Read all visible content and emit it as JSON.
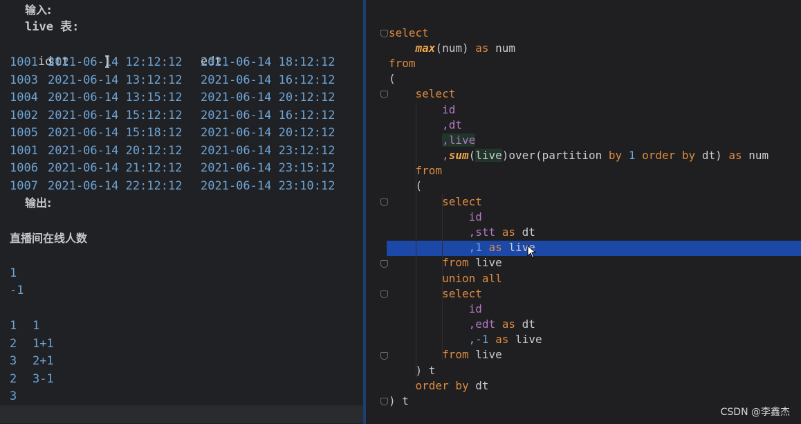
{
  "left": {
    "input_label": "输入:",
    "table_label": "live 表:",
    "header": [
      "id",
      "stt",
      "edt"
    ],
    "rows": [
      [
        "1001",
        "2021-06-14 12:12:12",
        "2021-06-14 18:12:12"
      ],
      [
        "1003",
        "2021-06-14 13:12:12",
        "2021-06-14 16:12:12"
      ],
      [
        "1004",
        "2021-06-14 13:15:12",
        "2021-06-14 20:12:12"
      ],
      [
        "1002",
        "2021-06-14 15:12:12",
        "2021-06-14 16:12:12"
      ],
      [
        "1005",
        "2021-06-14 15:18:12",
        "2021-06-14 20:12:12"
      ],
      [
        "1001",
        "2021-06-14 20:12:12",
        "2021-06-14 23:12:12"
      ],
      [
        "1006",
        "2021-06-14 21:12:12",
        "2021-06-14 23:15:12"
      ],
      [
        "1007",
        "2021-06-14 22:12:12",
        "2021-06-14 23:10:12"
      ]
    ],
    "output_label": "输出:",
    "note_title": "直播间在线人数",
    "plus_one": "1",
    "minus_one": "-1",
    "calc": [
      [
        "1",
        "1"
      ],
      [
        "2",
        "1+1"
      ],
      [
        "3",
        "2+1"
      ],
      [
        "2",
        "3-1"
      ],
      [
        "3",
        ""
      ]
    ],
    "last_line_fn": "sum",
    "last_line_parens": "()"
  },
  "sql": {
    "l1_select": "select",
    "l2_max": "max",
    "l2_args": "(num)",
    "l2_as": "as",
    "l2_num": "num",
    "l3_from": "from",
    "l4_paren": "(",
    "l5_select": "select",
    "l6_id": "id",
    "l7_dt": ",dt",
    "l8_live": ",live",
    "l9_comma": ",",
    "l9_sum": "sum",
    "l9_open": "(",
    "l9_live": "live",
    "l9_over": ")over(partition",
    "l9_by": "by",
    "l9_one": "1",
    "l9_order": "order by",
    "l9_dt": "dt)",
    "l9_as": "as",
    "l9_num": "num",
    "l10_from": "from",
    "l11_paren": "(",
    "l12_select": "select",
    "l13_id": "id",
    "l14_stt": ",stt",
    "l14_as": "as",
    "l14_dt": "dt",
    "l15_one": ",1",
    "l15_as": "as",
    "l15_live": "live",
    "l16_from": "from",
    "l16_live": "live",
    "l17_union": "union all",
    "l18_select": "select",
    "l19_id": "id",
    "l20_edt": ",edt",
    "l20_as": "as",
    "l20_dt": "dt",
    "l21_neg": ",-1",
    "l21_as": "as",
    "l21_live": "live",
    "l22_from": "from",
    "l22_live": "live",
    "l23_close": ") t",
    "l24_order": "order by",
    "l24_dt": "dt",
    "l25_close": ") t"
  },
  "watermark": "CSDN @李鑫杰"
}
